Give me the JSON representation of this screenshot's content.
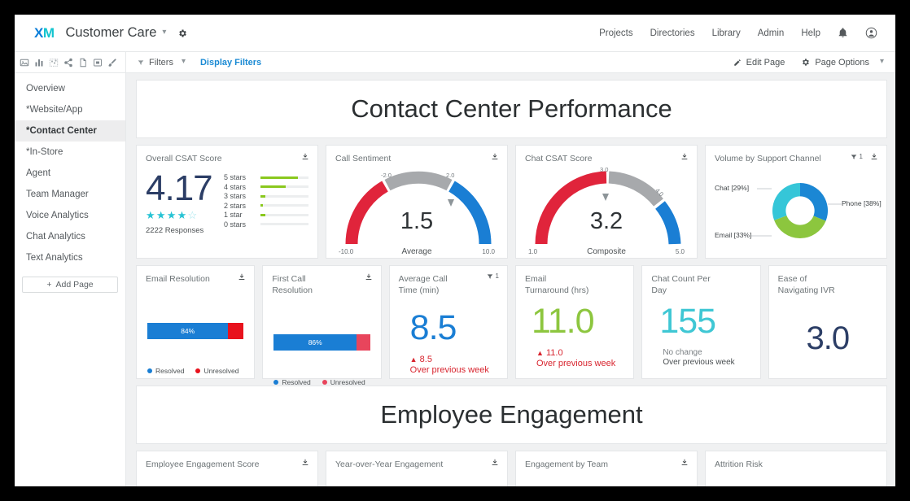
{
  "topnav": {
    "logo_x": "X",
    "logo_m": "M",
    "project_title": "Customer Care",
    "links": [
      "Projects",
      "Directories",
      "Library",
      "Admin",
      "Help"
    ]
  },
  "toolbar": {
    "filters_label": "Filters",
    "display_filters_label": "Display Filters",
    "edit_page_label": "Edit Page",
    "page_options_label": "Page Options",
    "icons": [
      "dashboard-icon",
      "bar-chart-icon",
      "scatter-icon",
      "share-icon",
      "document-icon",
      "video-icon",
      "paintbrush-icon"
    ]
  },
  "sidebar": {
    "items": [
      {
        "label": "Overview",
        "active": false
      },
      {
        "label": "*Website/App",
        "active": false
      },
      {
        "label": "*Contact Center",
        "active": true
      },
      {
        "label": "*In-Store",
        "active": false
      },
      {
        "label": "Agent",
        "active": false
      },
      {
        "label": "Team Manager",
        "active": false
      },
      {
        "label": "Voice Analytics",
        "active": false
      },
      {
        "label": "Chat Analytics",
        "active": false
      },
      {
        "label": "Text Analytics",
        "active": false
      }
    ],
    "add_page_label": "Add Page"
  },
  "banner1": "Contact Center Performance",
  "banner2": "Employee Engagement",
  "widgets": {
    "csat": {
      "title": "Overall CSAT Score",
      "score": "4.17",
      "stars_filled": 4,
      "stars_total": 5,
      "responses": "2222 Responses"
    },
    "call_sentiment": {
      "title": "Call Sentiment",
      "value": "1.5",
      "label": "Average",
      "min": "-10.0",
      "max": "10.0",
      "mark_low": "-2.0",
      "mark_high": "2.0"
    },
    "chat_csat": {
      "title": "Chat CSAT Score",
      "value": "3.2",
      "label": "Composite",
      "min": "1.0",
      "max": "5.0",
      "mark_low": "3.0",
      "mark_high": "4.0"
    },
    "volume": {
      "title": "Volume by Support Channel",
      "filter_count": "1",
      "labels": {
        "phone": "Phone [38%]",
        "email": "Email [33%]",
        "chat": "Chat [29%]"
      }
    },
    "email_resolution": {
      "title": "Email Resolution",
      "pct_label": "84%",
      "legend_a": "Resolved",
      "legend_b": "Unresolved"
    },
    "first_call_resolution": {
      "title": "First Call Resolution",
      "pct_label": "86%",
      "legend_a": "Resolved",
      "legend_b": "Unresolved"
    },
    "avg_call_time": {
      "title": "Average Call Time (min)",
      "filter_count": "1",
      "value": "8.5",
      "delta": "8.5",
      "delta_caption": "Over previous week"
    },
    "email_turnaround": {
      "title": "Email Turnaround (hrs)",
      "value": "11.0",
      "delta": "11.0",
      "delta_caption": "Over previous week"
    },
    "chat_count": {
      "title": "Chat Count Per Day",
      "value": "155",
      "delta": "No change",
      "delta_caption": "Over previous week"
    },
    "ivr": {
      "title": "Ease of Navigating IVR",
      "value": "3.0"
    },
    "bottom": [
      {
        "title": "Employee Engagement Score"
      },
      {
        "title": "Year-over-Year Engagement"
      },
      {
        "title": "Engagement by Team"
      },
      {
        "title": "Attrition Risk"
      }
    ]
  },
  "chart_data": [
    {
      "type": "bar",
      "title": "Overall CSAT Score distribution",
      "categories": [
        "5 stars",
        "4 stars",
        "3 stars",
        "2 stars",
        "1 star",
        "0 stars"
      ],
      "values": [
        78,
        52,
        10,
        5,
        10,
        0
      ],
      "xlabel": "",
      "ylabel": "",
      "ylim": [
        0,
        100
      ],
      "series_color": "#8ac81e"
    },
    {
      "type": "gauge",
      "title": "Call Sentiment",
      "value": 1.5,
      "min": -10.0,
      "max": 10.0,
      "bands": [
        {
          "from": -10.0,
          "to": -2.0,
          "color": "#e0243b"
        },
        {
          "from": -2.0,
          "to": 2.0,
          "color": "#a7a9ac"
        },
        {
          "from": 2.0,
          "to": 10.0,
          "color": "#1a7ed4"
        }
      ],
      "label": "Average"
    },
    {
      "type": "gauge",
      "title": "Chat CSAT Score",
      "value": 3.2,
      "min": 1.0,
      "max": 5.0,
      "bands": [
        {
          "from": 1.0,
          "to": 3.0,
          "color": "#e0243b"
        },
        {
          "from": 3.0,
          "to": 4.0,
          "color": "#a7a9ac"
        },
        {
          "from": 4.0,
          "to": 5.0,
          "color": "#1a7ed4"
        }
      ],
      "label": "Composite"
    },
    {
      "type": "pie",
      "title": "Volume by Support Channel",
      "categories": [
        "Phone",
        "Email",
        "Chat"
      ],
      "values": [
        38,
        33,
        29
      ],
      "colors": [
        "#1b87d4",
        "#8cc63e",
        "#35c6d8"
      ],
      "legend": "labels-outside",
      "donut": true
    },
    {
      "type": "bar",
      "title": "Email Resolution",
      "categories": [
        "Resolved",
        "Unresolved"
      ],
      "values": [
        84,
        16
      ],
      "colors": [
        "#1a7ed4",
        "#e8121d"
      ],
      "orientation": "horizontal-stacked"
    },
    {
      "type": "bar",
      "title": "First Call Resolution",
      "categories": [
        "Resolved",
        "Unresolved"
      ],
      "values": [
        86,
        14
      ],
      "colors": [
        "#1a7ed4",
        "#e8455c"
      ],
      "orientation": "horizontal-stacked"
    }
  ]
}
